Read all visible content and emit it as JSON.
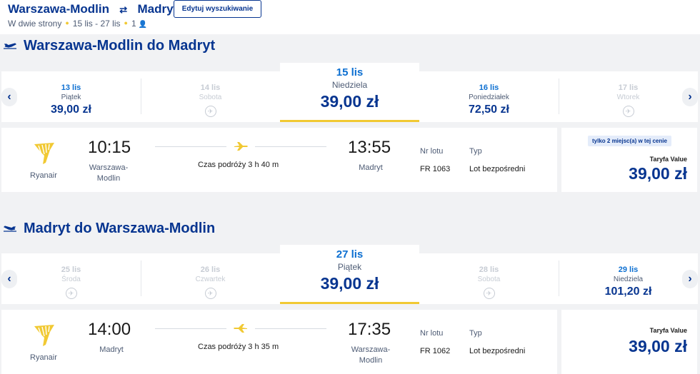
{
  "header": {
    "origin": "Warszawa-Modlin",
    "destination": "Madryt",
    "edit_button": "Edytuj wyszukiwanie",
    "trip_type": "W dwie strony",
    "dates": "15 lis - 27 lis",
    "passengers": "1"
  },
  "outbound": {
    "title": "Warszawa-Modlin do Madryt",
    "dates": [
      {
        "day": "13 lis",
        "weekday": "Piątek",
        "price": "39,00 zł",
        "available": true
      },
      {
        "day": "14 lis",
        "weekday": "Sobota",
        "price": "",
        "available": false
      },
      {
        "day": "15 lis",
        "weekday": "Niedziela",
        "price": "39,00 zł",
        "available": true,
        "selected": true
      },
      {
        "day": "16 lis",
        "weekday": "Poniedziałek",
        "price": "72,50 zł",
        "available": true
      },
      {
        "day": "17 lis",
        "weekday": "Wtorek",
        "price": "",
        "available": false
      }
    ],
    "flight": {
      "airline": "Ryanair",
      "dep_time": "10:15",
      "dep_city_1": "Warszawa-",
      "dep_city_2": "Modlin",
      "duration": "Czas podróży 3 h 40 m",
      "arr_time": "13:55",
      "arr_city_1": "Madryt",
      "arr_city_2": "",
      "flight_no_label": "Nr lotu",
      "flight_no": "FR 1063",
      "type_label": "Typ",
      "type": "Lot bezpośredni",
      "badge": "tylko 2 miejsc(a) w tej cenie",
      "tariff": "Taryfa Value",
      "price": "39,00 zł"
    }
  },
  "inbound": {
    "title": "Madryt do Warszawa-Modlin",
    "dates": [
      {
        "day": "25 lis",
        "weekday": "Środa",
        "price": "",
        "available": false
      },
      {
        "day": "26 lis",
        "weekday": "Czwartek",
        "price": "",
        "available": false
      },
      {
        "day": "27 lis",
        "weekday": "Piątek",
        "price": "39,00 zł",
        "available": true,
        "selected": true
      },
      {
        "day": "28 lis",
        "weekday": "Sobota",
        "price": "",
        "available": false
      },
      {
        "day": "29 lis",
        "weekday": "Niedziela",
        "price": "101,20 zł",
        "available": true
      }
    ],
    "flight": {
      "airline": "Ryanair",
      "dep_time": "14:00",
      "dep_city_1": "Madryt",
      "dep_city_2": "",
      "duration": "Czas podróży 3 h 35 m",
      "arr_time": "17:35",
      "arr_city_1": "Warszawa-",
      "arr_city_2": "Modlin",
      "flight_no_label": "Nr lotu",
      "flight_no": "FR 1062",
      "type_label": "Typ",
      "type": "Lot bezpośredni",
      "tariff": "Taryfa Value",
      "price": "39,00 zł"
    }
  },
  "colors": {
    "brand": "#073590",
    "accent": "#f1c933",
    "link": "#0c6fd1"
  },
  "icons": {
    "nav_prev": "‹",
    "nav_next": "›",
    "no_flight": "no-flight-icon"
  }
}
